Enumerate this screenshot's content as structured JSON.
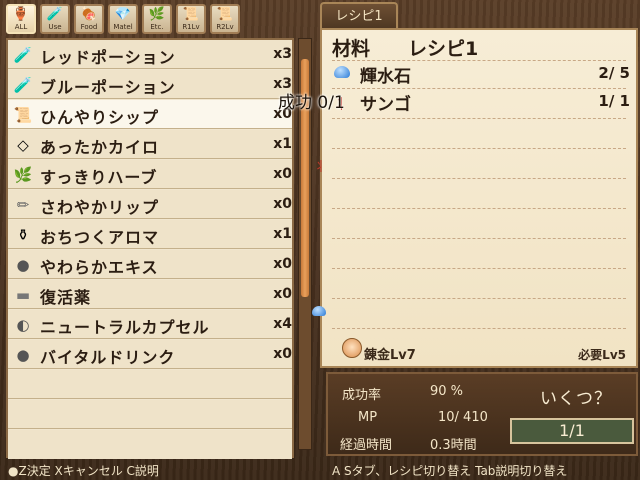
{
  "tabs": [
    {
      "label": "ALL",
      "icon": "pot"
    },
    {
      "label": "Use",
      "icon": "flask"
    },
    {
      "label": "Food",
      "icon": "meat"
    },
    {
      "label": "Matel",
      "icon": "gem"
    },
    {
      "label": "Etc.",
      "icon": "misc"
    },
    {
      "label": "R1Lv",
      "icon": "scroll"
    },
    {
      "label": "R2Lv",
      "icon": "scroll"
    }
  ],
  "items": [
    {
      "name": "レッドポーション",
      "count": "x3",
      "icon": "🧪"
    },
    {
      "name": "ブルーポーション",
      "count": "x3",
      "icon": "🧪"
    },
    {
      "name": "ひんやりシップ",
      "count": "x0",
      "icon": "📜"
    },
    {
      "name": "あったかカイロ",
      "count": "x1",
      "icon": "◇"
    },
    {
      "name": "すっきりハーブ",
      "count": "x0",
      "icon": "🌿"
    },
    {
      "name": "さわやかリップ",
      "count": "x0",
      "icon": "✏"
    },
    {
      "name": "おちつくアロマ",
      "count": "x1",
      "icon": "⚱"
    },
    {
      "name": "やわらかエキス",
      "count": "x0",
      "icon": "●"
    },
    {
      "name": "復活薬",
      "count": "x0",
      "icon": "▬"
    },
    {
      "name": "ニュートラルカプセル",
      "count": "x4",
      "icon": "◐"
    },
    {
      "name": "バイタルドリンク",
      "count": "x0",
      "icon": "●"
    }
  ],
  "recipe": {
    "tab_label": "レシピ1",
    "header_left": "材料",
    "header_right": "レシピ1",
    "materials": [
      {
        "name": "輝水石",
        "qty": "2/  5"
      },
      {
        "name": "サンゴ",
        "qty": "1/  1"
      }
    ],
    "alchemy_level": "錬金Lv7",
    "required_level": "必要Lv5"
  },
  "overlay": "成功 0/1",
  "info": {
    "success_label": "成功率",
    "success_value": "90 %",
    "mp_label": "MP",
    "mp_value": "10/  410",
    "time_label": "経過時間",
    "time_value": "0.3時間",
    "qty_title": "いくつ？",
    "qty_value": "1/1"
  },
  "status": {
    "left": "●Z決定  Xキャンセル C説明",
    "right": "A Sタブ、レシピ切り替え Tab説明切り替え"
  }
}
